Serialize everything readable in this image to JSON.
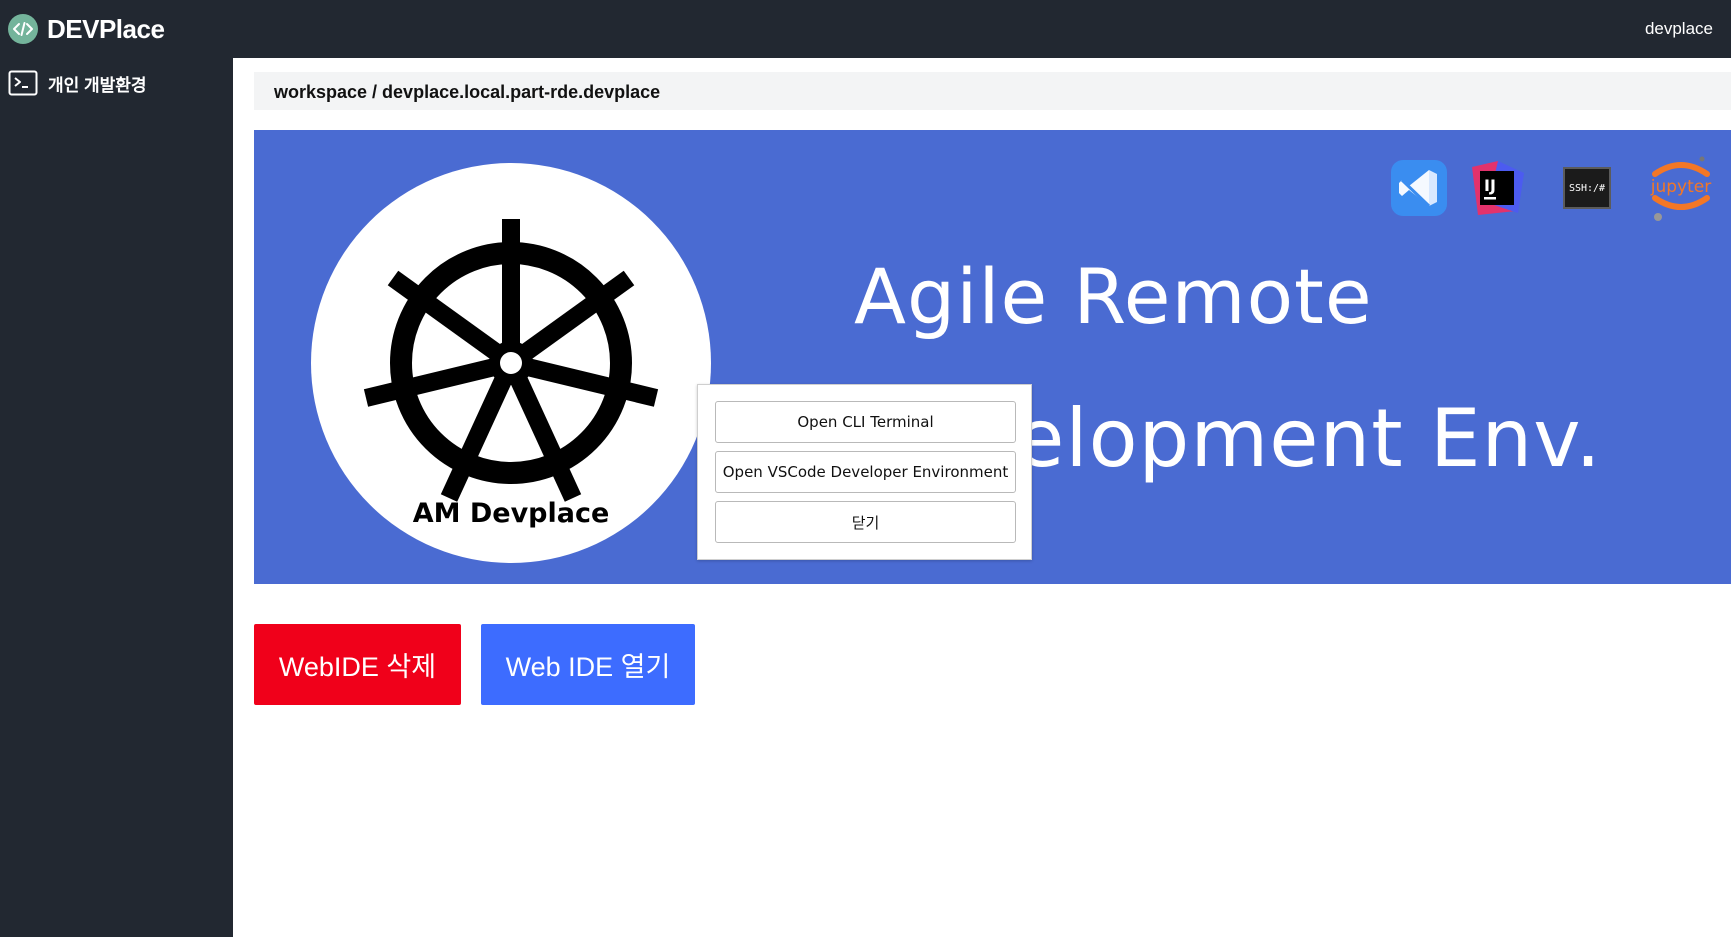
{
  "app": {
    "brand_name": "DEVPlace",
    "user_name": "devplace"
  },
  "sidebar": {
    "items": [
      {
        "label": "개인 개발환경",
        "icon": "terminal-icon"
      }
    ]
  },
  "breadcrumb": "workspace / devplace.local.part-rde.devplace",
  "banner": {
    "logo_text": "AM Devplace",
    "hero_line1": "Agile Remote",
    "hero_line2": "Development Env.",
    "tools": [
      "vscode-icon",
      "intellij-icon",
      "ssh-icon",
      "jupyter-icon"
    ],
    "intellij_label": "IJ",
    "ssh_label": "SSH:/#",
    "jupyter_label": "jupyter"
  },
  "popup": {
    "buttons": [
      "Open CLI Terminal",
      "Open VSCode Developer Environment",
      "닫기"
    ]
  },
  "actions": {
    "delete_label": "WebIDE 삭제",
    "open_label": "Web IDE 열기"
  },
  "colors": {
    "topbar": "#222831",
    "banner": "#4a6bd2",
    "delete": "#f0001a",
    "open": "#3d6cff",
    "brand_icon": "#74b49b"
  }
}
